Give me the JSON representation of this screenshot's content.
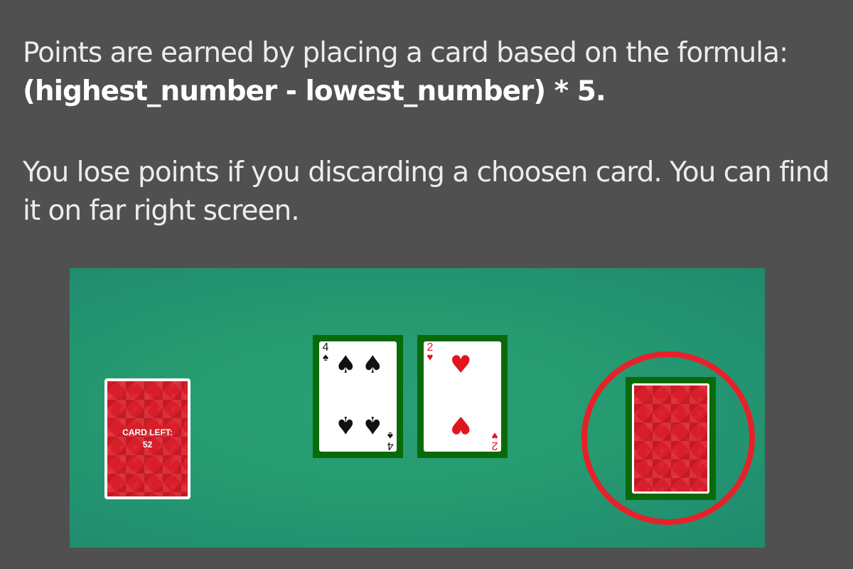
{
  "instructions": {
    "paragraph1_text": "Points are earned by placing a card based on the formula: ",
    "paragraph1_formula": "(highest_number - lowest_number) * 5.",
    "paragraph2": "You lose points if you discarding a choosen card. You can find it on far right screen."
  },
  "deck": {
    "label_line1": "CARD LEFT:",
    "label_line2": "52"
  },
  "cards": [
    {
      "rank": "4",
      "suit": "♠",
      "color": "#111111"
    },
    {
      "rank": "2",
      "suit": "♥",
      "color": "#e2141e"
    }
  ],
  "colors": {
    "background": "#505050",
    "table": "#269a70",
    "slot": "#0a6a0a",
    "card_back": "#d61f2a",
    "highlight": "#e8202a"
  },
  "icons": {
    "spade": "spade-icon",
    "heart": "heart-icon"
  }
}
